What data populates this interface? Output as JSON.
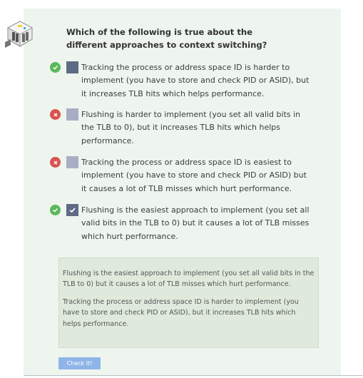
{
  "question": "Which of the following is true about the different approaches to context switching?",
  "answers": [
    {
      "text": "Tracking the process or address space ID is harder to implement (you have to store and check PID or ASID), but it increases TLB hits which helps performance.",
      "status": "correct",
      "selected": true
    },
    {
      "text": "Flushing is harder to implement (you set all valid bits in the TLB to 0), but it increases TLB hits which helps performance.",
      "status": "incorrect",
      "selected": false
    },
    {
      "text": "Tracking the process or address space ID is easiest to implement (you have to store and check PID or ASID) but it causes a lot of TLB misses which hurt performance.",
      "status": "incorrect",
      "selected": false
    },
    {
      "text": "Flushing is the easiest approach to implement (you set all valid bits in the TLB to 0) but it causes a lot of TLB misses which hurt performance.",
      "status": "correct",
      "selected": true
    }
  ],
  "feedback": [
    "Flushing is the easiest approach to implement (you set all valid bits in the TLB to 0) but it causes a lot of TLB misses which hurt performance.",
    "Tracking the process or address space ID is harder to implement (you have to store and check PID or ASID), but it increases TLB hits which helps performance."
  ],
  "check_button": "Check It!",
  "colors": {
    "correct": "#5cb85c",
    "incorrect": "#d9534f",
    "card": "#eef5ee",
    "feedback_bg": "#dfeadd",
    "button": "#8fb5e8"
  },
  "icons": {
    "correct": "check-circle-icon",
    "incorrect": "x-circle-icon",
    "logo": "server-room-icon"
  }
}
